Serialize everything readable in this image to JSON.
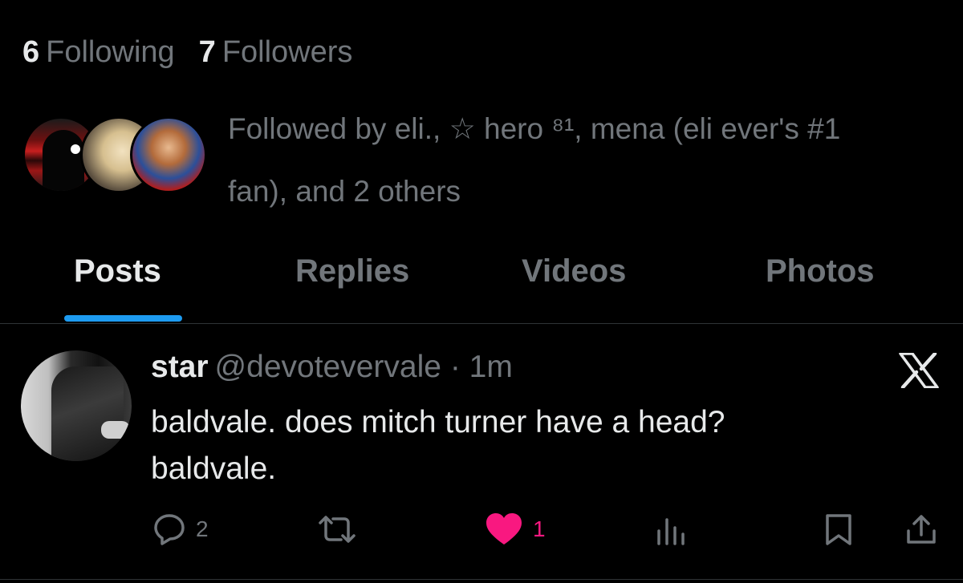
{
  "profile": {
    "following_count": "6",
    "following_label": "Following",
    "followers_count": "7",
    "followers_label": "Followers",
    "followed_by_line1": "Followed by eli., ☆ hero ⁸¹, mena (eli ever's #1",
    "followed_by_line2": "fan), and 2 others"
  },
  "tabs": [
    {
      "label": "Posts",
      "active": true
    },
    {
      "label": "Replies",
      "active": false
    },
    {
      "label": "Videos",
      "active": false
    },
    {
      "label": "Photos",
      "active": false
    }
  ],
  "post": {
    "display_name": "star",
    "handle": "@devotevervale",
    "separator": "·",
    "time": "1m",
    "text_line1": "baldvale. does mitch turner have a head?",
    "text_line2": "baldvale.",
    "reply_count": "2",
    "like_count": "1"
  },
  "icons": {
    "reply": "reply-icon",
    "repost": "repost-icon",
    "like": "heart-icon",
    "views": "views-icon",
    "bookmark": "bookmark-icon",
    "share": "share-icon",
    "brand": "x-logo-icon"
  },
  "colors": {
    "background": "#000000",
    "text_primary": "#e7e9ea",
    "text_secondary": "#71767b",
    "accent_blue": "#1d9bf0",
    "like_pink": "#f91880",
    "divider": "#2f3336"
  }
}
